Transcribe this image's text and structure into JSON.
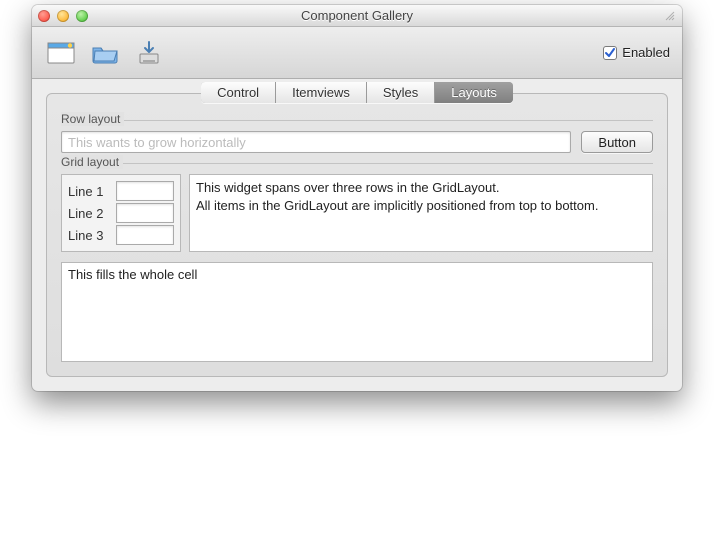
{
  "window": {
    "title": "Component Gallery"
  },
  "toolbar": {
    "enabled_label": "Enabled",
    "enabled_checked": true
  },
  "tabs": [
    {
      "label": "Control",
      "active": false
    },
    {
      "label": "Itemviews",
      "active": false
    },
    {
      "label": "Styles",
      "active": false
    },
    {
      "label": "Layouts",
      "active": true
    }
  ],
  "row_layout": {
    "group_label": "Row layout",
    "input_placeholder": "This wants to grow horizontally",
    "input_value": "",
    "button_label": "Button"
  },
  "grid_layout": {
    "group_label": "Grid layout",
    "lines": [
      {
        "label": "Line 1",
        "value": ""
      },
      {
        "label": "Line 2",
        "value": ""
      },
      {
        "label": "Line 3",
        "value": ""
      }
    ],
    "span_text": "This widget spans over three rows in the GridLayout.\nAll items in the GridLayout are implicitly positioned from top to bottom.",
    "fill_text": "This fills the whole cell"
  }
}
